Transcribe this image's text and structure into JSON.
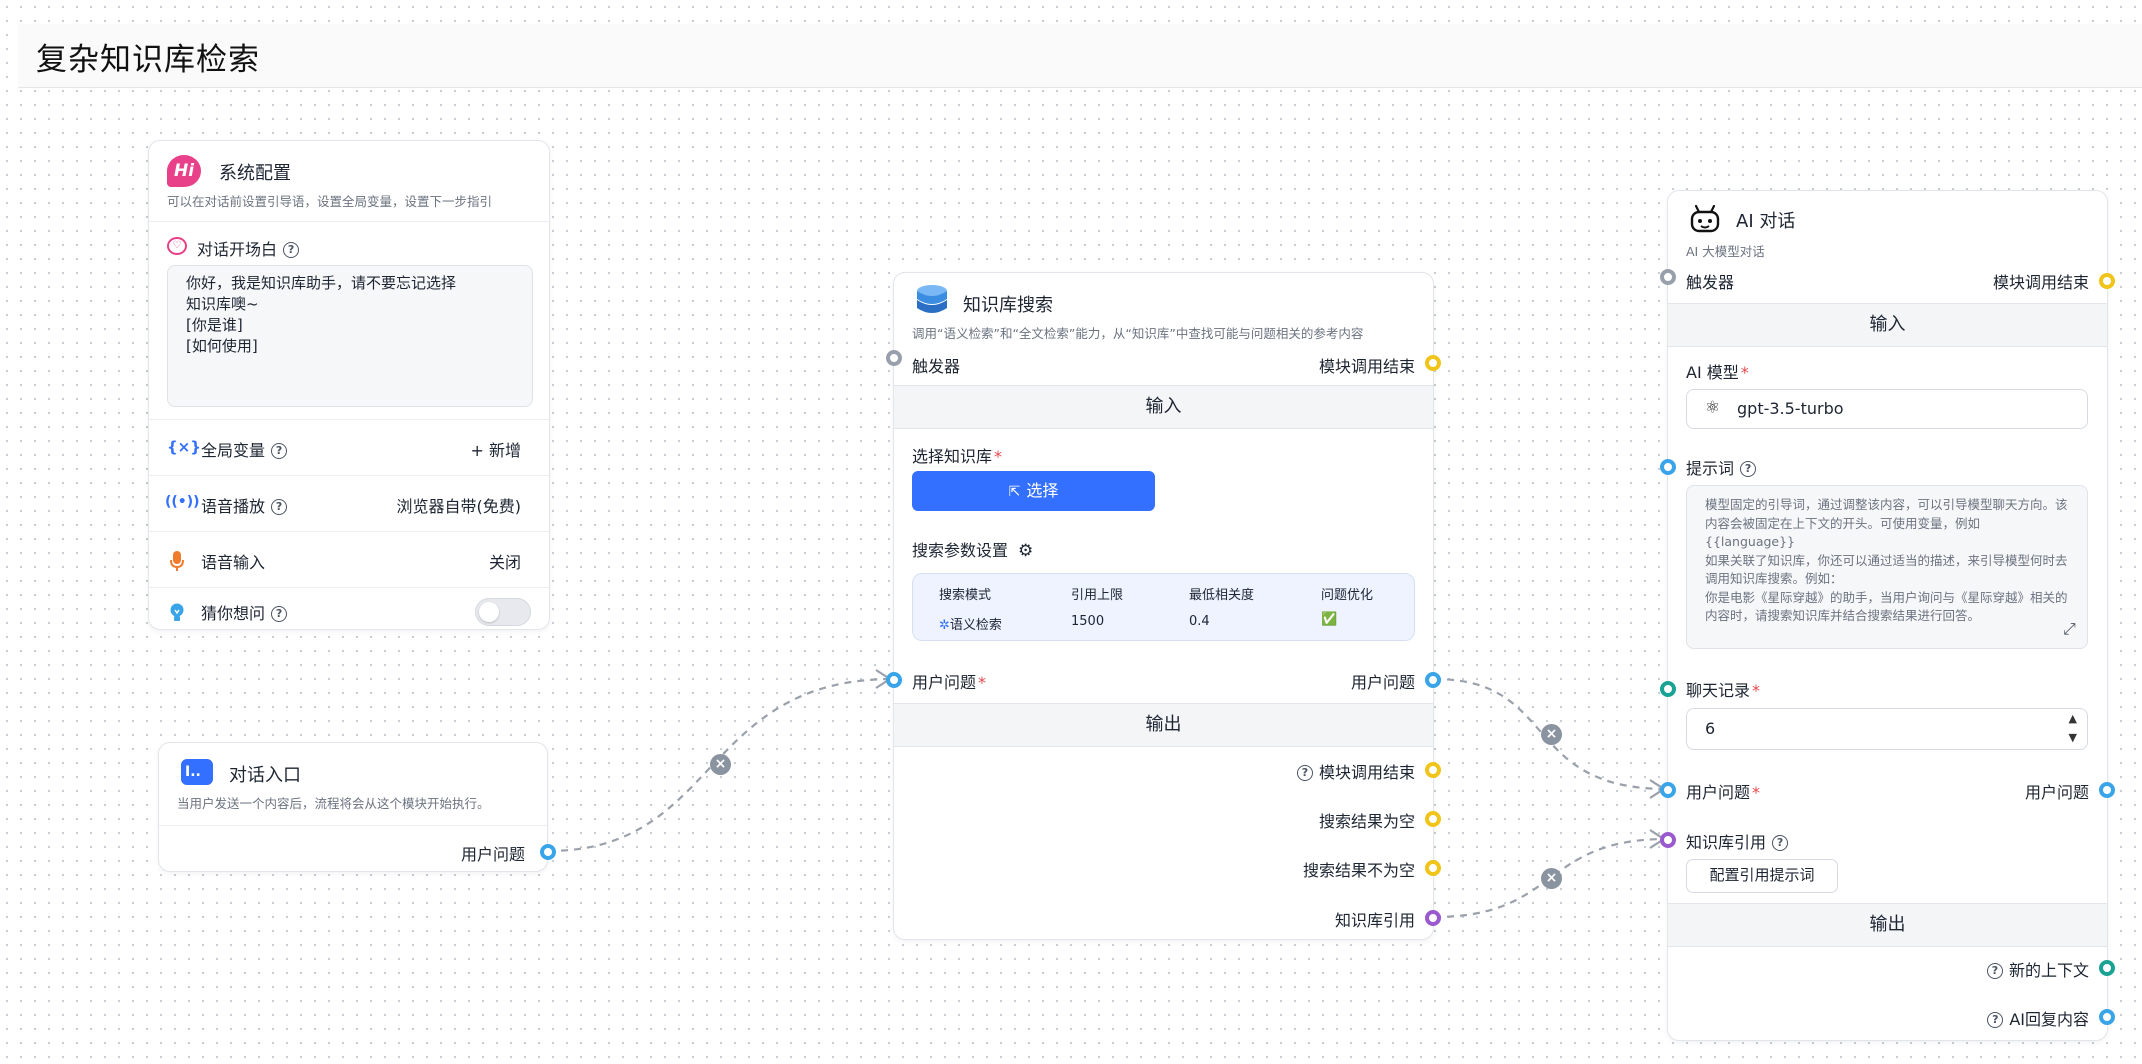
{
  "page_title": "复杂知识库检索",
  "nodes": {
    "system_config": {
      "title": "系统配置",
      "badge": "Hi",
      "desc": "可以在对话前设置引导语，设置全局变量，设置下一步指引",
      "welcome_label": "对话开场白",
      "welcome_text": "你好，我是知识库助手，请不要忘记选择\n知识库噢~\n[你是谁]\n[如何使用]",
      "global_vars_label": "全局变量",
      "global_vars_action": "+ 新增",
      "voice_play_label": "语音播放",
      "voice_play_value": "浏览器自带(免费)",
      "voice_input_label": "语音输入",
      "voice_input_value": "关闭",
      "guess_label": "猜你想问"
    },
    "chat_entry": {
      "title": "对话入口",
      "badge": "I..",
      "desc": "当用户发送一个内容后，流程将会从这个模块开始执行。",
      "output_label": "用户问题"
    },
    "kb_search": {
      "title": "知识库搜索",
      "desc": "调用“语义检索”和“全文检索”能力，从“知识库”中查找可能与问题相关的参考内容",
      "trigger_label": "触发器",
      "finish_label": "模块调用结束",
      "input_section": "输入",
      "select_kb_label": "选择知识库",
      "select_button": "选择",
      "search_params_label": "搜索参数设置",
      "params_headers": [
        "搜索模式",
        "引用上限",
        "最低相关度",
        "问题优化"
      ],
      "params_values": [
        "语义检索",
        "1500",
        "0.4",
        "✅"
      ],
      "user_question_in": "用户问题",
      "user_question_out": "用户问题",
      "output_section": "输出",
      "outputs": [
        "模块调用结束",
        "搜索结果为空",
        "搜索结果不为空",
        "知识库引用"
      ]
    },
    "ai_chat": {
      "title": "AI 对话",
      "desc": "AI 大模型对话",
      "trigger_label": "触发器",
      "finish_label": "模块调用结束",
      "input_section": "输入",
      "model_label": "AI 模型",
      "model_value": "gpt-3.5-turbo",
      "prompt_label": "提示词",
      "prompt_placeholder": "模型固定的引导词，通过调整该内容，可以引导模型聊天方向。该内容会被固定在上下文的开头。可使用变量，例如 {{language}}\n如果关联了知识库，你还可以通过适当的描述，来引导模型何时去调用知识库搜索。例如：\n你是电影《星际穿越》的助手，当用户询问与《星际穿越》相关的内容时，请搜索知识库并结合搜索结果进行回答。",
      "history_label": "聊天记录",
      "history_value": "6",
      "user_question_in": "用户问题",
      "user_question_out": "用户问题",
      "kb_quote_label": "知识库引用",
      "quote_prompt_button": "配置引用提示词",
      "output_section": "输出",
      "outputs": [
        "新的上下文",
        "AI回复内容"
      ]
    }
  },
  "colors": {
    "accent": "#3370ff",
    "handle_gray": "#98a0ab",
    "handle_yellow": "#f0c419",
    "handle_blue": "#3aa4e8",
    "handle_purple": "#9b59d0",
    "handle_teal": "#1aa394",
    "edge": "#9aa1ab"
  },
  "icons": {
    "system_config": "hi-badge-icon",
    "welcome": "heart-chat-icon",
    "global_vars": "variable-braces-icon",
    "voice_play": "broadcast-icon",
    "voice_input": "microphone-icon",
    "guess": "lightbulb-icon",
    "chat_entry": "input-badge-icon",
    "kb_search": "database-icon",
    "select": "cursor-click-icon",
    "settings": "gear-icon",
    "semantic": "semantic-search-icon",
    "ai_chat": "robot-icon",
    "model": "openai-icon",
    "expand": "expand-icon",
    "edge_remove": "close-circle-icon"
  }
}
